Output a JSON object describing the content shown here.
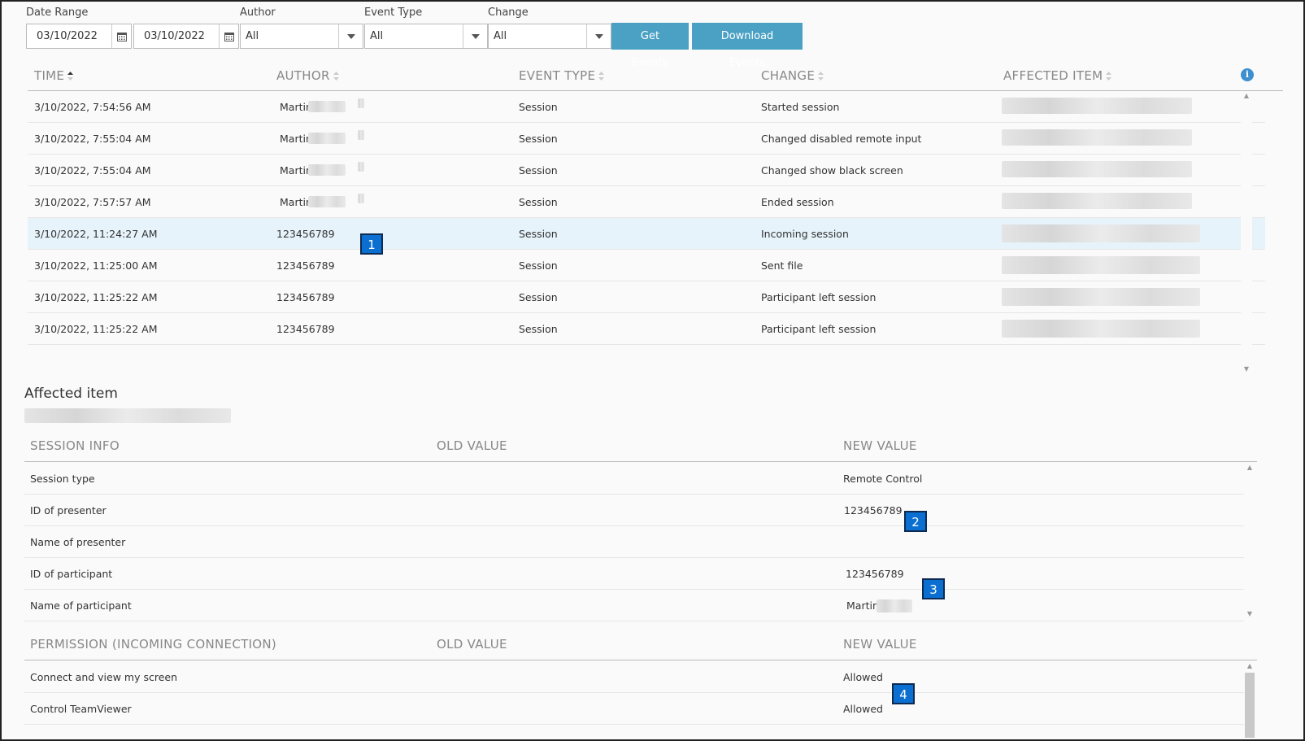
{
  "filters": {
    "date_range_label": "Date Range",
    "date_from": "03/10/2022",
    "date_to": "03/10/2022",
    "author_label": "Author",
    "author_value": "All",
    "event_type_label": "Event Type",
    "event_type_value": "All",
    "change_label": "Change",
    "change_value": "All",
    "get_events_label": "Get Events",
    "download_events_label": "Download Events"
  },
  "events_table": {
    "columns": [
      "TIME",
      "AUTHOR",
      "EVENT TYPE",
      "CHANGE",
      "AFFECTED ITEM"
    ],
    "rows": [
      {
        "time": "3/10/2022, 7:54:56 AM",
        "author": "Martin",
        "event_type": "Session",
        "change": "Started session"
      },
      {
        "time": "3/10/2022, 7:55:04 AM",
        "author": "Martin",
        "event_type": "Session",
        "change": "Changed disabled remote input"
      },
      {
        "time": "3/10/2022, 7:55:04 AM",
        "author": "Martin",
        "event_type": "Session",
        "change": "Changed show black screen"
      },
      {
        "time": "3/10/2022, 7:57:57 AM",
        "author": "Martin",
        "event_type": "Session",
        "change": "Ended session"
      },
      {
        "time": "3/10/2022, 11:24:27 AM",
        "author": "123456789",
        "event_type": "Session",
        "change": "Incoming session",
        "selected": true
      },
      {
        "time": "3/10/2022, 11:25:00 AM",
        "author": "123456789",
        "event_type": "Session",
        "change": "Sent file"
      },
      {
        "time": "3/10/2022, 11:25:22 AM",
        "author": "123456789",
        "event_type": "Session",
        "change": "Participant left session"
      },
      {
        "time": "3/10/2022, 11:25:22 AM",
        "author": "123456789",
        "event_type": "Session",
        "change": "Participant left session"
      }
    ]
  },
  "affected_item": {
    "title": "Affected item"
  },
  "session_info": {
    "columns": [
      "SESSION INFO",
      "OLD VALUE",
      "NEW VALUE"
    ],
    "rows": [
      {
        "label": "Session type",
        "old": "",
        "new": "Remote Control"
      },
      {
        "label": "ID of presenter",
        "old": "",
        "new": "123456789"
      },
      {
        "label": "Name of presenter",
        "old": "",
        "new": ""
      },
      {
        "label": "ID of participant",
        "old": "",
        "new": "123456789"
      },
      {
        "label": "Name of participant",
        "old": "",
        "new": "Martin"
      }
    ]
  },
  "permission": {
    "columns": [
      "PERMISSION (INCOMING CONNECTION)",
      "OLD VALUE",
      "NEW VALUE"
    ],
    "rows": [
      {
        "label": "Connect and view my screen",
        "old": "",
        "new": "Allowed"
      },
      {
        "label": "Control TeamViewer",
        "old": "",
        "new": "Allowed"
      }
    ]
  },
  "callouts": [
    "1",
    "2",
    "3",
    "4"
  ],
  "colors": {
    "button": "#4aa1c4",
    "badge": "#0a6fd1",
    "selected_row": "#e6f3fa",
    "info_icon": "#3d8fd0"
  },
  "icons": {
    "calendar": "calendar-icon",
    "dropdown": "chevron-down-icon",
    "sort": "sort-icon",
    "info": "info-icon"
  }
}
